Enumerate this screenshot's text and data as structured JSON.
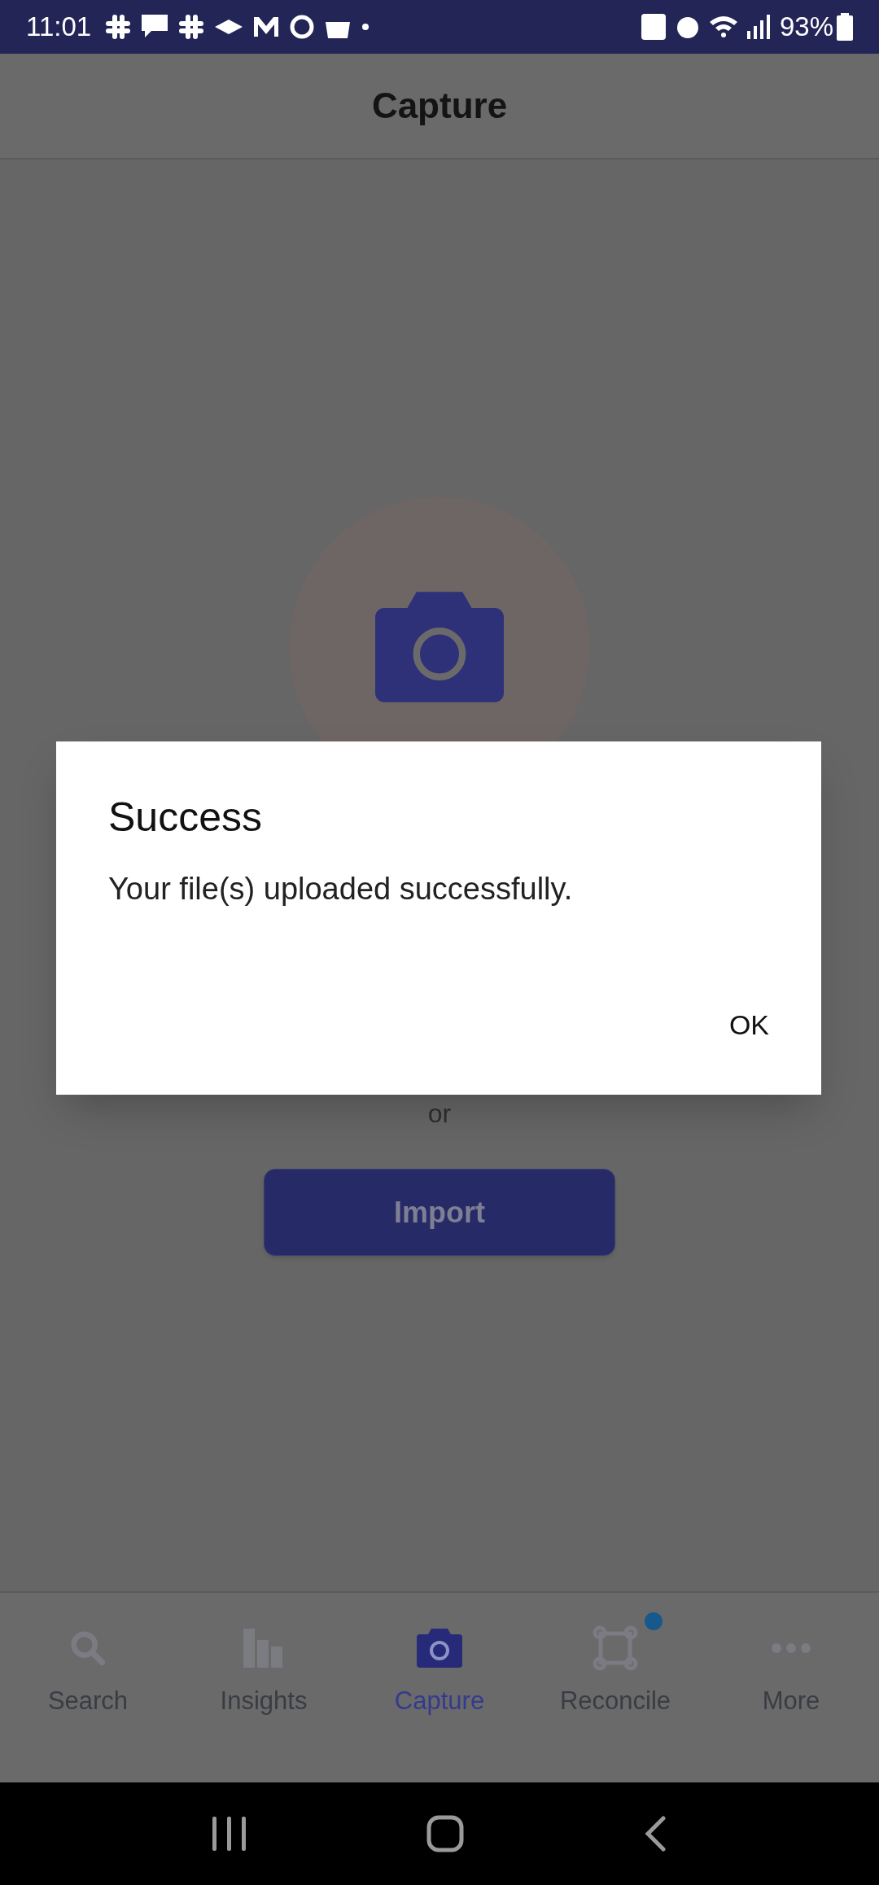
{
  "status_bar": {
    "time": "11:01",
    "battery": "93%"
  },
  "header": {
    "title": "Capture"
  },
  "capture": {
    "separator": "or",
    "import_button": "Import"
  },
  "dialog": {
    "title": "Success",
    "message": "Your file(s) uploaded successfully.",
    "buttons": [
      "OK"
    ]
  },
  "bottom_nav": [
    {
      "label": "Search",
      "selected": false,
      "badge": false
    },
    {
      "label": "Insights",
      "selected": false,
      "badge": false
    },
    {
      "label": "Capture",
      "selected": true,
      "badge": false
    },
    {
      "label": "Reconcile",
      "selected": false,
      "badge": true
    },
    {
      "label": "More",
      "selected": false,
      "badge": false
    }
  ]
}
